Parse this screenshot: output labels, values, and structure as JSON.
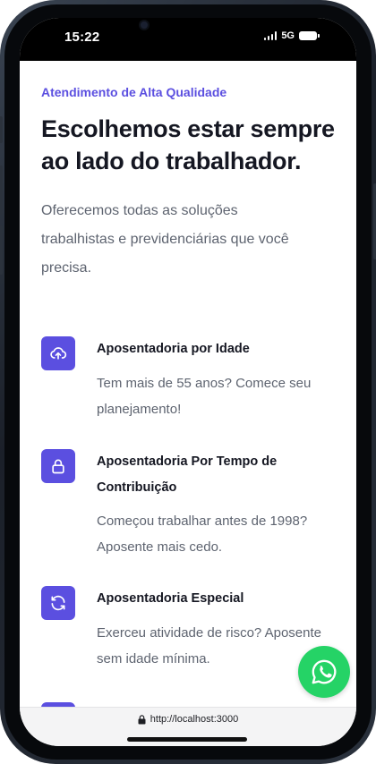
{
  "status_bar": {
    "time": "15:22",
    "network": "5G"
  },
  "hero": {
    "eyebrow": "Atendimento de Alta Qualidade",
    "headline": "Escolhemos estar sempre ao lado do trabalhador.",
    "intro": "Oferecemos todas as soluções trabalhistas e previdenciárias que você precisa."
  },
  "services": [
    {
      "icon": "cloud-upload-icon",
      "title": "Aposentadoria por Idade",
      "description": "Tem mais de 55 anos? Comece seu planejamento!"
    },
    {
      "icon": "lock-icon",
      "title": "Aposentadoria Por Tempo de Contribuição",
      "description": "Começou trabalhar antes de 1998? Aposente mais cedo."
    },
    {
      "icon": "refresh-icon",
      "title": "Aposentadoria Especial",
      "description": "Exerceu atividade de risco? Aposente sem idade mínima."
    }
  ],
  "browser": {
    "url": "http://localhost:3000"
  },
  "colors": {
    "accent": "#5b4fe0",
    "heading": "#151722",
    "body_text": "#5e6470",
    "whatsapp": "#25d366"
  }
}
